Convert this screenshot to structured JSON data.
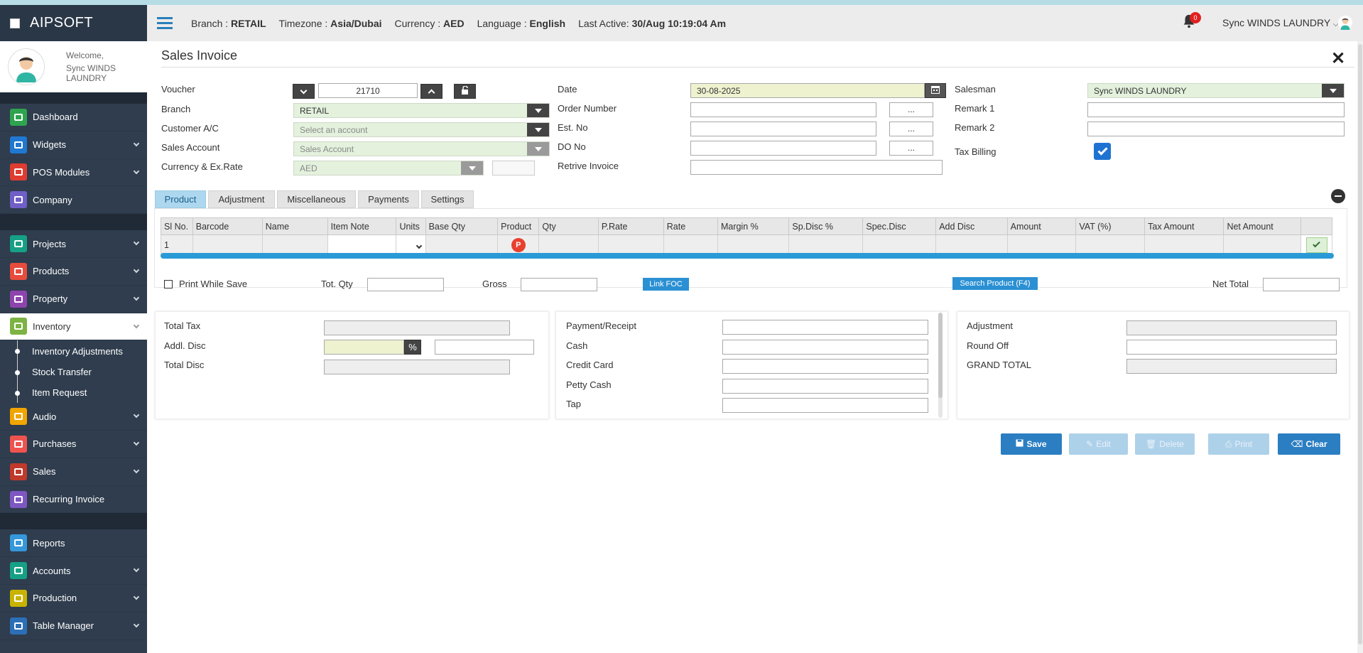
{
  "app": {
    "brand": "AIPSOFT"
  },
  "user": {
    "welcome": "Welcome,",
    "name": "Sync WINDS LAUNDRY"
  },
  "topbar": {
    "branch_label": "Branch :",
    "branch_value": "RETAIL",
    "timezone_label": "Timezone :",
    "timezone_value": "Asia/Dubai",
    "currency_label": "Currency :",
    "currency_value": "AED",
    "language_label": "Language :",
    "language_value": "English",
    "last_active_label": "Last Active:",
    "last_active_value": "30/Aug 10:19:04 Am",
    "notifications": "0",
    "user_menu": "Sync WINDS LAUNDRY"
  },
  "sidebar": {
    "items_a": [
      {
        "label": "Dashboard",
        "icon": "dashboard-icon",
        "color": "#2ea44f"
      },
      {
        "label": "Widgets",
        "icon": "sliders-icon",
        "color": "#1f78d1"
      },
      {
        "label": "POS Modules",
        "icon": "edit-icon",
        "color": "#e03c31"
      },
      {
        "label": "Company",
        "icon": "building-icon",
        "color": "#6f5fc7"
      }
    ],
    "items_b": [
      {
        "label": "Projects",
        "icon": "projects-icon",
        "color": "#16a085"
      },
      {
        "label": "Products",
        "icon": "products-icon",
        "color": "#e74c3c"
      },
      {
        "label": "Property",
        "icon": "property-icon",
        "color": "#8e44ad"
      },
      {
        "label": "Inventory",
        "icon": "grid-icon",
        "color": "#7cb342"
      }
    ],
    "inventory_sub": [
      "Inventory Adjustments",
      "Stock Transfer",
      "Item Request"
    ],
    "items_c": [
      {
        "label": "Audio",
        "icon": "mic-icon",
        "color": "#f1a500"
      },
      {
        "label": "Purchases",
        "icon": "cart-icon",
        "color": "#ef5350"
      },
      {
        "label": "Sales",
        "icon": "sales-icon",
        "color": "#c0392b"
      },
      {
        "label": "Recurring Invoice",
        "icon": "invoice-icon",
        "color": "#7e57c2"
      }
    ],
    "items_d": [
      {
        "label": "Reports",
        "icon": "file-icon",
        "color": "#3498db"
      },
      {
        "label": "Accounts",
        "icon": "users-icon",
        "color": "#16a085"
      },
      {
        "label": "Production",
        "icon": "table-icon",
        "color": "#c8b400"
      },
      {
        "label": "Table Manager",
        "icon": "table-icon",
        "color": "#2c6fb7"
      }
    ]
  },
  "page": {
    "title": "Sales Invoice",
    "voucher_label": "Voucher",
    "voucher_value": "21710",
    "branch_label": "Branch",
    "branch_value": "RETAIL",
    "customer_label": "Customer A/C",
    "customer_placeholder": "Select an account",
    "sales_account_label": "Sales Account",
    "sales_account_value": "Sales Account",
    "currency_label": "Currency & Ex.Rate",
    "currency_value": "AED",
    "date_label": "Date",
    "date_value": "30-08-2025",
    "order_label": "Order Number",
    "est_label": "Est. No",
    "do_label": "DO No",
    "retrive_label": "Retrive Invoice",
    "dots": "...",
    "salesman_label": "Salesman",
    "salesman_value": "Sync WINDS LAUNDRY",
    "remark1_label": "Remark 1",
    "remark2_label": "Remark 2",
    "tax_billing_label": "Tax Billing"
  },
  "tabs": [
    "Product",
    "Adjustment",
    "Miscellaneous",
    "Payments",
    "Settings"
  ],
  "grid": {
    "columns": [
      "Sl No.",
      "Barcode",
      "Name",
      "Item Note",
      "Units",
      "Base Qty",
      "Product",
      "Qty",
      "P.Rate",
      "Rate",
      "Margin %",
      "Sp.Disc %",
      "Spec.Disc",
      "Add Disc",
      "Amount",
      "VAT (%)",
      "Tax Amount",
      "Net Amount",
      ""
    ],
    "row_sl": "1",
    "product_badge": "P"
  },
  "footer_row": {
    "print_while_save": "Print While Save",
    "tot_qty": "Tot. Qty",
    "gross": "Gross",
    "link_foc": "Link FOC",
    "search_product": "Search Product (F4)",
    "net_total": "Net Total"
  },
  "summary_left": {
    "total_tax": "Total Tax",
    "addl_disc": "Addl. Disc",
    "percent": "%",
    "total_disc": "Total Disc"
  },
  "summary_mid": [
    "Payment/Receipt",
    "Cash",
    "Credit Card",
    "Petty Cash",
    "Tap"
  ],
  "summary_right": {
    "adjustment": "Adjustment",
    "round_off": "Round Off",
    "grand_total": "GRAND TOTAL"
  },
  "actions": {
    "save": "Save",
    "edit": "Edit",
    "delete": "Delete",
    "print": "Print",
    "clear": "Clear"
  }
}
